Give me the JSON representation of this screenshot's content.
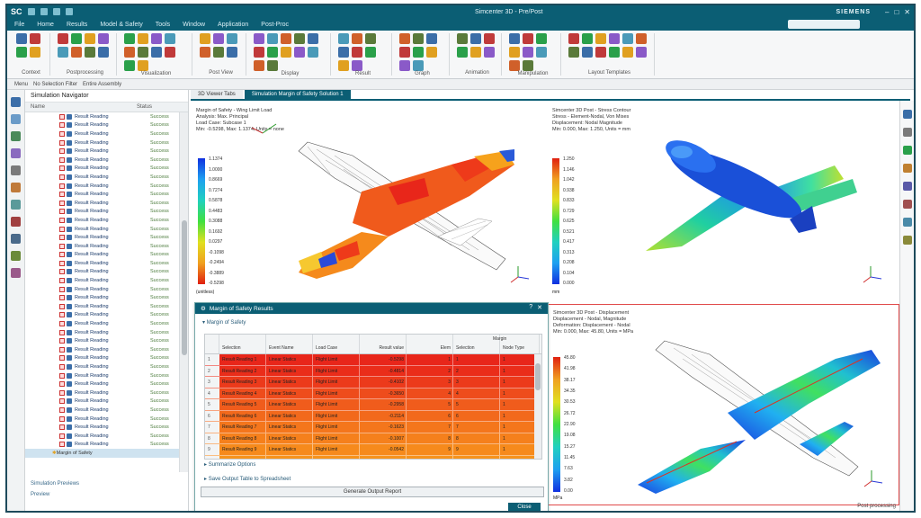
{
  "window": {
    "logo": "SC",
    "title": "Simcenter 3D - Pre/Post",
    "brand": "SIEMENS",
    "controls": [
      "–",
      "□",
      "✕"
    ]
  },
  "menu": [
    "File",
    "Home",
    "Results",
    "Model & Safety",
    "Tools",
    "Window",
    "Application",
    "Post-Proc"
  ],
  "ribbon_groups": [
    {
      "label": "Context"
    },
    {
      "label": "Postprocessing"
    },
    {
      "label": "Visualization"
    },
    {
      "label": "Post View"
    },
    {
      "label": "Display"
    },
    {
      "label": "Result"
    },
    {
      "label": "Graph"
    },
    {
      "label": "Animation"
    },
    {
      "label": "Manipulation"
    },
    {
      "label": "Layout Templates"
    }
  ],
  "toolrow": [
    "Menu",
    "No Selection Filter",
    "Entire Assembly"
  ],
  "navigator": {
    "title": "Simulation Navigator",
    "columns": [
      "Name",
      "Status"
    ],
    "row_name": "Result Reading",
    "row_status": "Success",
    "row_count": 39,
    "selected_label": "Margin of Safety",
    "footer": [
      "Simulation Previews",
      "Preview"
    ]
  },
  "tabs": [
    {
      "label": "3D Viewer Tabs"
    },
    {
      "label": "Simulation Margin of Safety Solution 1",
      "active": true
    }
  ],
  "viewports": [
    {
      "title_lines": [
        "Margin of Safety - Wing Limit Load",
        "Analysis: Max. Principal",
        "Load Case: Subcase 1",
        "Min: -0.5298, Max: 1.1374, Units = none"
      ],
      "legend_values": [
        "1.1374",
        "1.0000",
        "0.8669",
        "0.7274",
        "0.5878",
        "0.4483",
        "0.3088",
        "0.1692",
        "0.0297",
        "-0.1098",
        "-0.2494",
        "-0.3889",
        "-0.5298"
      ],
      "legend_footer": "(unitless)"
    },
    {
      "title_lines": [
        "Simcenter 3D Post - Stress Contour",
        "Stress - Element-Nodal, Von Mises",
        "Displacement: Nodal Magnitude",
        "Min: 0.000, Max: 1.250, Units = mm"
      ],
      "legend_values": [
        "1.250",
        "1.146",
        "1.042",
        "0.938",
        "0.833",
        "0.729",
        "0.625",
        "0.521",
        "0.417",
        "0.313",
        "0.208",
        "0.104",
        "0.000"
      ],
      "legend_footer": "mm"
    },
    {
      "title_lines": [
        "Simcenter 3D Post - Displacement",
        "Displacement - Nodal, Magnitude",
        "Deformation: Displacement - Nodal",
        "Min: 0.000, Max: 45.80, Units = MPa"
      ],
      "legend_values": [
        "45.80",
        "41.98",
        "38.17",
        "34.35",
        "30.53",
        "26.72",
        "22.90",
        "19.08",
        "15.27",
        "11.45",
        "7.63",
        "3.82",
        "0.00"
      ],
      "legend_footer": "MPa"
    }
  ],
  "dialog": {
    "title": "Margin of Safety Results",
    "section1": "Margin of Safety",
    "headers": [
      "",
      "Selection",
      "Event Name",
      "Load Case",
      "Result value",
      "Elem",
      "Selection",
      "Node Type"
    ],
    "header_group": "Margin",
    "rows": [
      {
        "idx": "1",
        "sel": "Result Reading 1",
        "ev": "Linear Statics",
        "lc": "Flight Limit",
        "val": "-0.5298",
        "elem": "1",
        "s2": "1",
        "nt": "1",
        "color": "#e8261a"
      },
      {
        "idx": "2",
        "sel": "Result Reading 2",
        "ev": "Linear Statics",
        "lc": "Flight Limit",
        "val": "-0.4814",
        "elem": "2",
        "s2": "2",
        "nt": "1",
        "color": "#ea2d1a"
      },
      {
        "idx": "3",
        "sel": "Result Reading 3",
        "ev": "Linear Statics",
        "lc": "Flight Limit",
        "val": "-0.4102",
        "elem": "3",
        "s2": "3",
        "nt": "1",
        "color": "#ec3a1b"
      },
      {
        "idx": "4",
        "sel": "Result Reading 4",
        "ev": "Linear Statics",
        "lc": "Flight Limit",
        "val": "-0.3650",
        "elem": "4",
        "s2": "4",
        "nt": "1",
        "color": "#ee4c1c"
      },
      {
        "idx": "5",
        "sel": "Result Reading 5",
        "ev": "Linear Statics",
        "lc": "Flight Limit",
        "val": "-0.2958",
        "elem": "5",
        "s2": "5",
        "nt": "1",
        "color": "#f05c1c"
      },
      {
        "idx": "6",
        "sel": "Result Reading 6",
        "ev": "Linear Statics",
        "lc": "Flight Limit",
        "val": "-0.2114",
        "elem": "6",
        "s2": "6",
        "nt": "1",
        "color": "#f2691c"
      },
      {
        "idx": "7",
        "sel": "Result Reading 7",
        "ev": "Linear Statics",
        "lc": "Flight Limit",
        "val": "-0.1623",
        "elem": "7",
        "s2": "7",
        "nt": "1",
        "color": "#f4761c"
      },
      {
        "idx": "8",
        "sel": "Result Reading 8",
        "ev": "Linear Statics",
        "lc": "Flight Limit",
        "val": "-0.1007",
        "elem": "8",
        "s2": "8",
        "nt": "1",
        "color": "#f5801c"
      },
      {
        "idx": "9",
        "sel": "Result Reading 9",
        "ev": "Linear Statics",
        "lc": "Flight Limit",
        "val": "-0.0542",
        "elem": "9",
        "s2": "9",
        "nt": "1",
        "color": "#f68a1c"
      },
      {
        "idx": "10",
        "sel": "Result Reading 10",
        "ev": "Linear Statics",
        "lc": "Flight Limit",
        "val": "0.0126",
        "elem": "10",
        "s2": "10",
        "nt": "1",
        "color": "#f7931c"
      },
      {
        "idx": "11",
        "sel": "Result Reading 11",
        "ev": "Linear Statics",
        "lc": "Flight Limit",
        "val": "0.0811",
        "elem": "11",
        "s2": "11",
        "nt": "1",
        "color": "#f89b1d"
      }
    ],
    "section2": "Summarize Options",
    "section3": "Save Output Table to Spreadsheet",
    "action_button": "Generate Output Report",
    "close_button": "Close"
  },
  "status": "Post processing"
}
